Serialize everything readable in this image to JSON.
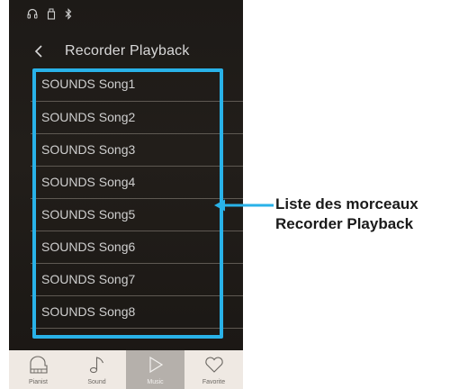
{
  "screen": {
    "title": "Recorder Playback"
  },
  "songs": [
    "SOUNDS Song1",
    "SOUNDS Song2",
    "SOUNDS Song3",
    "SOUNDS Song4",
    "SOUNDS Song5",
    "SOUNDS Song6",
    "SOUNDS Song7",
    "SOUNDS Song8"
  ],
  "tabs": [
    {
      "label": "Pianist",
      "icon": "piano-icon"
    },
    {
      "label": "Sound",
      "icon": "music-note-icon"
    },
    {
      "label": "Music",
      "icon": "play-icon"
    },
    {
      "label": "Favorite",
      "icon": "heart-icon"
    }
  ],
  "active_tab": "Music",
  "callout": {
    "line1": "Liste des morceaux",
    "line2": "Recorder Playback"
  },
  "colors": {
    "highlight": "#29b2e8",
    "callout_text": "#1a1a1a"
  }
}
